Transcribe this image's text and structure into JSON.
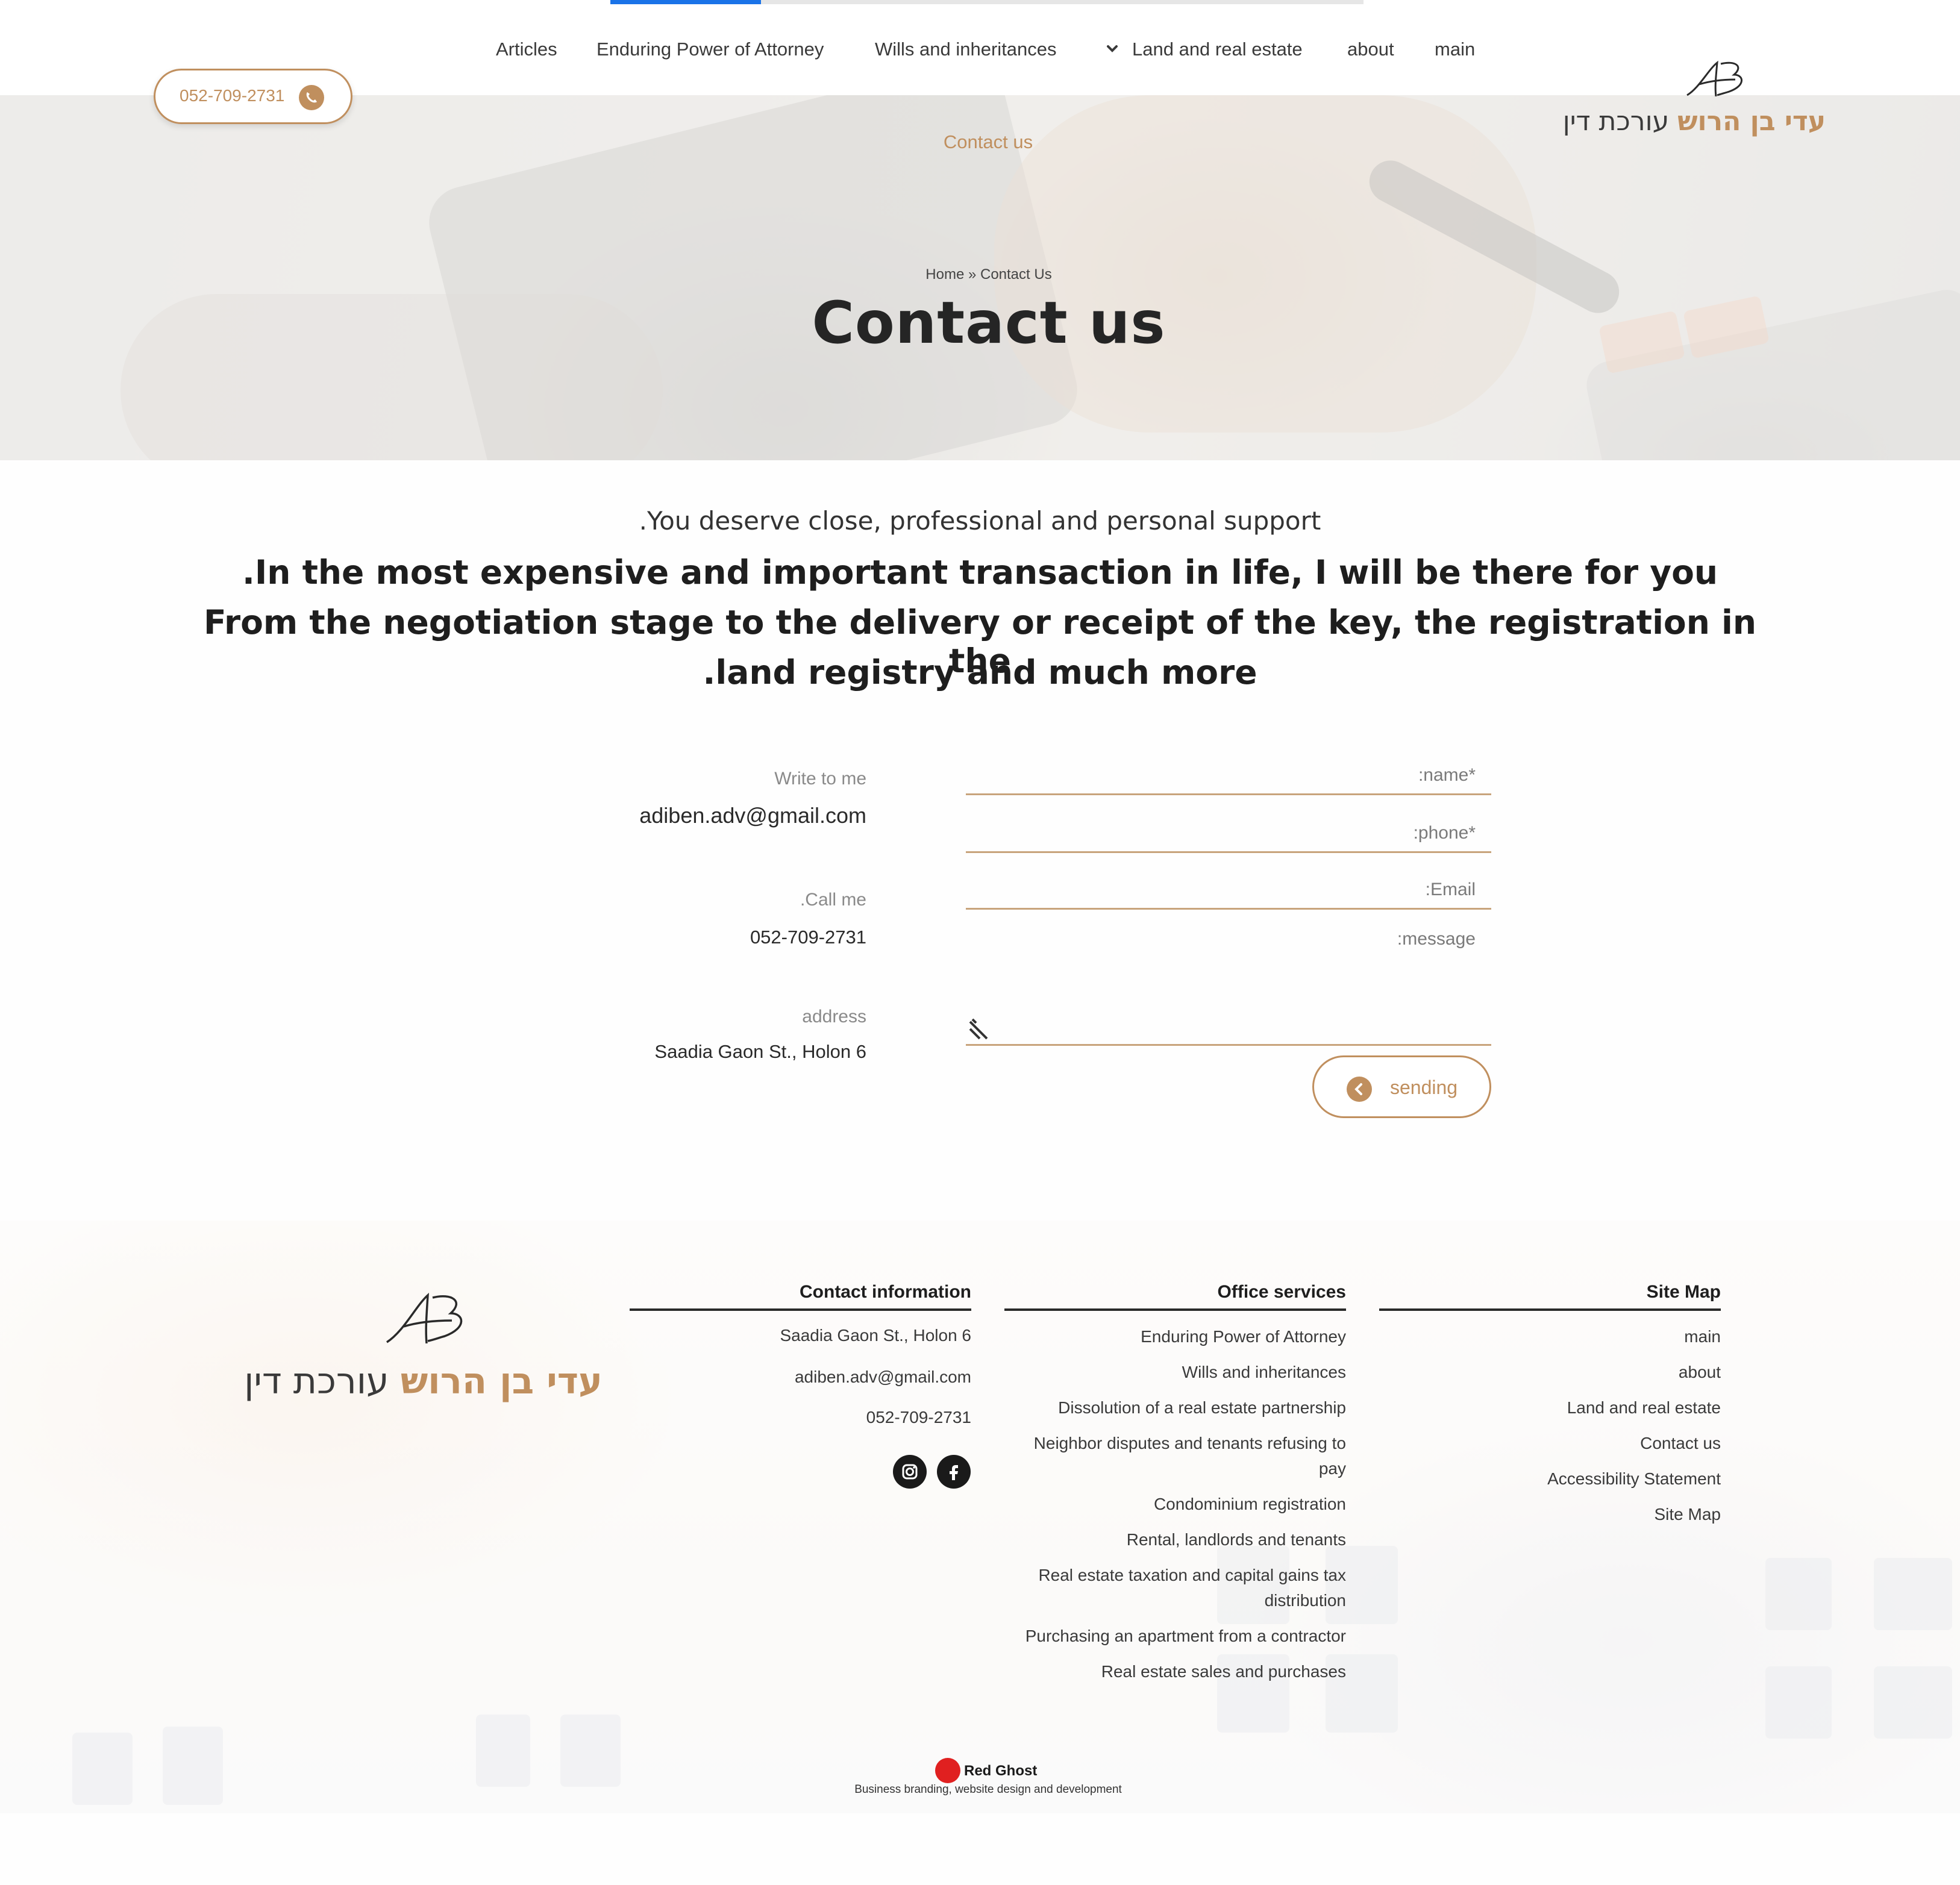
{
  "nav": {
    "items": [
      "Articles",
      "Enduring Power of Attorney",
      "Wills and inheritances",
      "Land and real estate",
      "about",
      "main"
    ],
    "phone": "052-709-2731"
  },
  "logo": {
    "strong": "עדי בן הרוש",
    "light": "עורכת דין",
    "monogram": "AB"
  },
  "hero": {
    "contact_link": "Contact us",
    "breadcrumb": "Home » Contact Us",
    "title": "Contact us"
  },
  "intro": {
    "subtitle": ".You deserve close, professional and personal support",
    "lines": [
      ".In the most expensive and important transaction in life, I will be there for you",
      "From the negotiation stage to the delivery or receipt of the key, the registration in the",
      ".land registry and much more"
    ]
  },
  "contact_info": {
    "write_label": "Write to me",
    "email": "adiben.adv@gmail.com",
    "call_label": ".Call me",
    "phone": "052-709-2731",
    "address_label": "address",
    "address": "Saadia Gaon St., Holon 6"
  },
  "form": {
    "name_placeholder": ":name*",
    "phone_placeholder": ":phone*",
    "email_placeholder": ":Email",
    "message_placeholder": ":message",
    "send_label": "sending"
  },
  "footer": {
    "contact_title": "Contact information",
    "contact_items": [
      "Saadia Gaon St., Holon 6",
      "adiben.adv@gmail.com",
      "052-709-2731"
    ],
    "services_title": "Office services",
    "services": [
      "Enduring Power of Attorney",
      "Wills and inheritances",
      "Dissolution of a real estate partnership",
      "Neighbor disputes and tenants refusing to pay",
      "Condominium registration",
      "Rental, landlords and tenants",
      "Real estate taxation and capital gains tax distribution",
      "Purchasing an apartment from a contractor",
      "Real estate sales and purchases"
    ],
    "sitemap_title": "Site Map",
    "sitemap": [
      "main",
      "about",
      "Land and real estate",
      "Contact us",
      "Accessibility Statement",
      "Site Map"
    ],
    "social": [
      "instagram-icon",
      "facebook-icon"
    ],
    "credit_brand": "Red Ghost",
    "credit_tagline": "Business branding, website design and development"
  },
  "colors": {
    "accent": "#c08f5e",
    "field_line": "#c8a47c",
    "text_dark": "#1e1e1e",
    "progress": "#1a73e8",
    "credit_red": "#e02020"
  },
  "scroll_progress": 0.2
}
